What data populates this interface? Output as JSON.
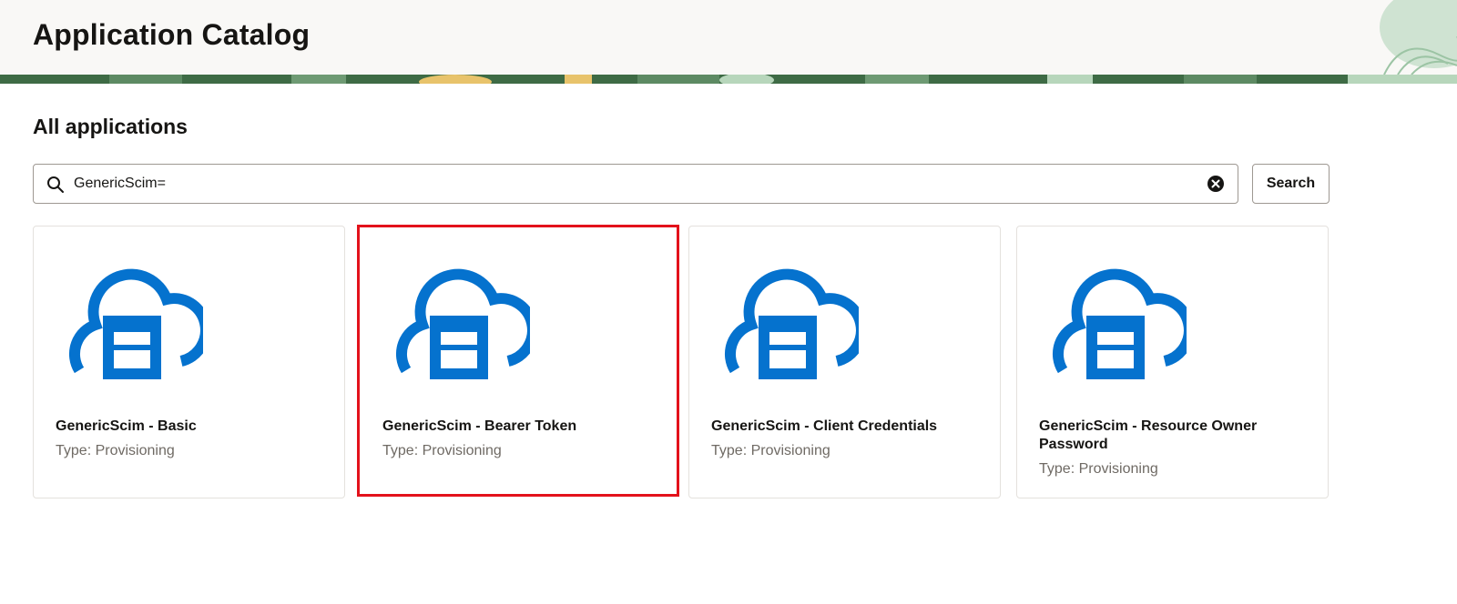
{
  "header": {
    "title": "Application Catalog"
  },
  "section": {
    "title": "All applications"
  },
  "search": {
    "value": "GenericScim=",
    "button_label": "Search"
  },
  "icons": {
    "search": "search-icon",
    "clear": "clear-circle-icon",
    "app": "cloud-app-icon"
  },
  "colors": {
    "icon_blue": "#0572ce",
    "highlight_red": "#e3121b"
  },
  "apps": [
    {
      "name": "GenericScim - Basic",
      "type": "Type: Provisioning"
    },
    {
      "name": "GenericScim - Bearer Token",
      "type": "Type: Provisioning"
    },
    {
      "name": "GenericScim - Client Credentials",
      "type": "Type: Provisioning"
    },
    {
      "name": "GenericScim - Resource Owner Password",
      "type": "Type: Provisioning"
    }
  ]
}
